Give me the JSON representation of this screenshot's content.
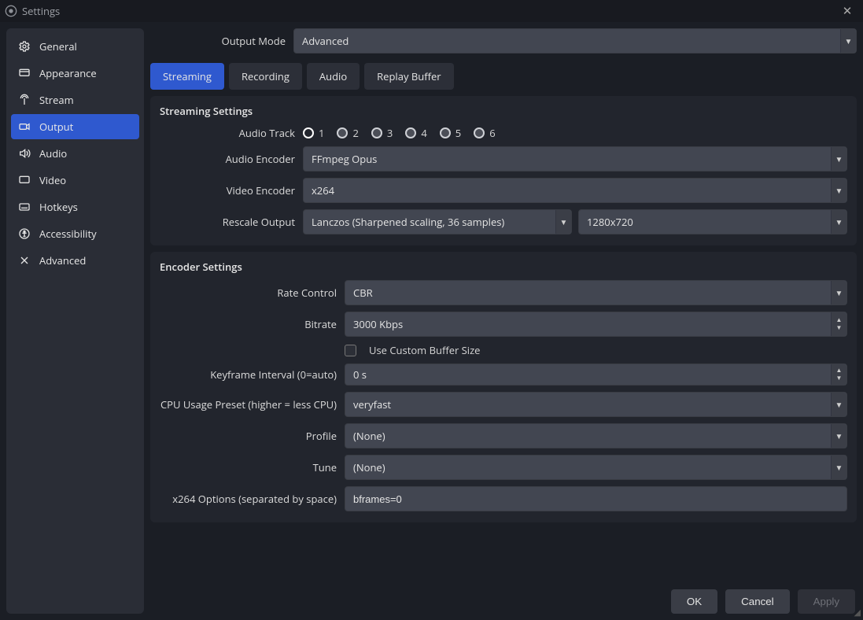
{
  "window": {
    "title": "Settings"
  },
  "sidebar": {
    "items": [
      {
        "label": "General",
        "icon": "gear"
      },
      {
        "label": "Appearance",
        "icon": "appearance"
      },
      {
        "label": "Stream",
        "icon": "antenna"
      },
      {
        "label": "Output",
        "icon": "camera"
      },
      {
        "label": "Audio",
        "icon": "speaker"
      },
      {
        "label": "Video",
        "icon": "monitor"
      },
      {
        "label": "Hotkeys",
        "icon": "keyboard"
      },
      {
        "label": "Accessibility",
        "icon": "accessibility"
      },
      {
        "label": "Advanced",
        "icon": "tools"
      }
    ],
    "active_index": 3
  },
  "output_mode": {
    "label": "Output Mode",
    "value": "Advanced"
  },
  "tabs": {
    "items": [
      "Streaming",
      "Recording",
      "Audio",
      "Replay Buffer"
    ],
    "active_index": 0
  },
  "streaming_section": {
    "title": "Streaming Settings",
    "audio_track": {
      "label": "Audio Track",
      "options": [
        "1",
        "2",
        "3",
        "4",
        "5",
        "6"
      ],
      "selected": "1"
    },
    "audio_encoder": {
      "label": "Audio Encoder",
      "value": "FFmpeg Opus"
    },
    "video_encoder": {
      "label": "Video Encoder",
      "value": "x264"
    },
    "rescale_output": {
      "label": "Rescale Output",
      "method": "Lanczos (Sharpened scaling, 36 samples)",
      "resolution": "1280x720"
    }
  },
  "encoder_section": {
    "title": "Encoder Settings",
    "rate_control": {
      "label": "Rate Control",
      "value": "CBR"
    },
    "bitrate": {
      "label": "Bitrate",
      "value": "3000 Kbps"
    },
    "custom_buffer": {
      "label": "Use Custom Buffer Size",
      "checked": false
    },
    "keyframe": {
      "label": "Keyframe Interval (0=auto)",
      "value": "0 s"
    },
    "cpu_preset": {
      "label": "CPU Usage Preset (higher = less CPU)",
      "value": "veryfast"
    },
    "profile": {
      "label": "Profile",
      "value": "(None)"
    },
    "tune": {
      "label": "Tune",
      "value": "(None)"
    },
    "x264_opts": {
      "label": "x264 Options (separated by space)",
      "value": "bframes=0"
    }
  },
  "footer": {
    "ok": "OK",
    "cancel": "Cancel",
    "apply": "Apply"
  }
}
